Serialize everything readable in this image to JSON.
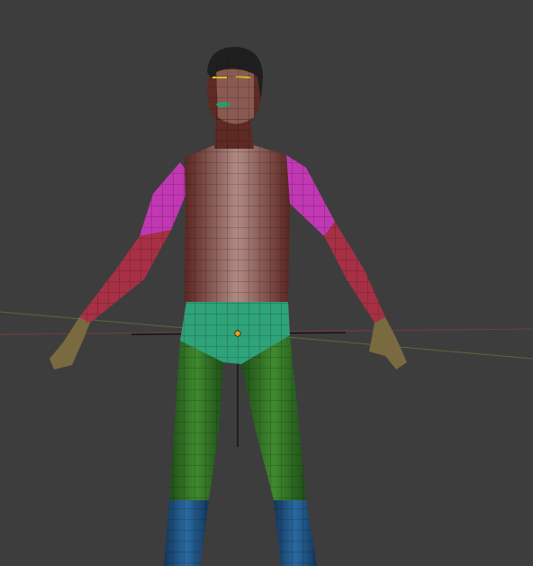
{
  "viewport": {
    "background": "#3d3d3d",
    "grid_line_color": "#474747",
    "x_axis_color": "#8a3a3a",
    "y_axis_color": "#6b7a3a",
    "origin_color": "#f2a019"
  },
  "model": {
    "material_colors": {
      "skin": "#5e2a24",
      "skin_light": "#b98f88",
      "hair": "#1f1f1f",
      "upper_arm": "#c238b4",
      "forearm": "#b23244",
      "hand": "#7a6a3f",
      "shorts": "#2fa37a",
      "legs": "#2f6a22",
      "boots": "#1c4b7a",
      "wire": "#111111",
      "eyebrow": "#d6c21a",
      "lips": "#2f9b6a"
    }
  },
  "icons": {
    "origin": "origin-dot-icon",
    "cursor": "3d-cursor-icon"
  }
}
